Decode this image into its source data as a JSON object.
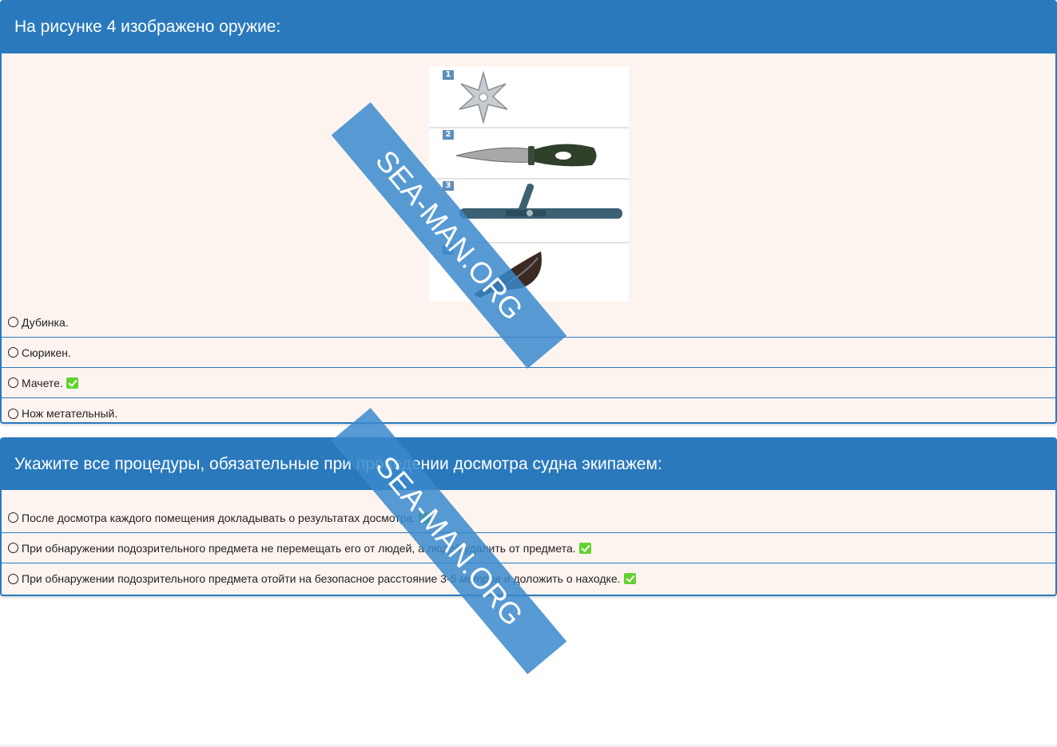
{
  "question1": {
    "title": "На рисунке 4 изображено оружие:",
    "figure": {
      "labels": [
        "1",
        "2",
        "3",
        "4"
      ],
      "items": [
        "shuriken-icon",
        "knife-icon",
        "baton-icon",
        "machete-icon"
      ]
    },
    "options": [
      {
        "label": "Дубинка.",
        "correct": false
      },
      {
        "label": "Сюрикен.",
        "correct": false
      },
      {
        "label": "Мачете.",
        "correct": true
      },
      {
        "label": "Нож метательный.",
        "correct": false
      }
    ]
  },
  "question2": {
    "title": "Укажите все процедуры, обязательные при проведении досмотра судна экипажем:",
    "options": [
      {
        "label": "После досмотра каждого помещения докладывать о результатах досмотра.",
        "correct": true
      },
      {
        "label": "При обнаружении подозрительного предмета не перемещать его от людей, а людей удалить от предмета.",
        "correct": true
      },
      {
        "label_before": "При обнаружении подозрительного предмета отойти на безопасное расстояние 3-5 ",
        "label_em": "метров",
        "label_after": " и доложить о находке.",
        "correct": true
      }
    ]
  },
  "watermark": "SEA-MAN.ORG",
  "colors": {
    "header": "#2a79bd",
    "card_bg": "#fdf4f0",
    "check": "#62d130",
    "watermark": "#3a88cd"
  }
}
